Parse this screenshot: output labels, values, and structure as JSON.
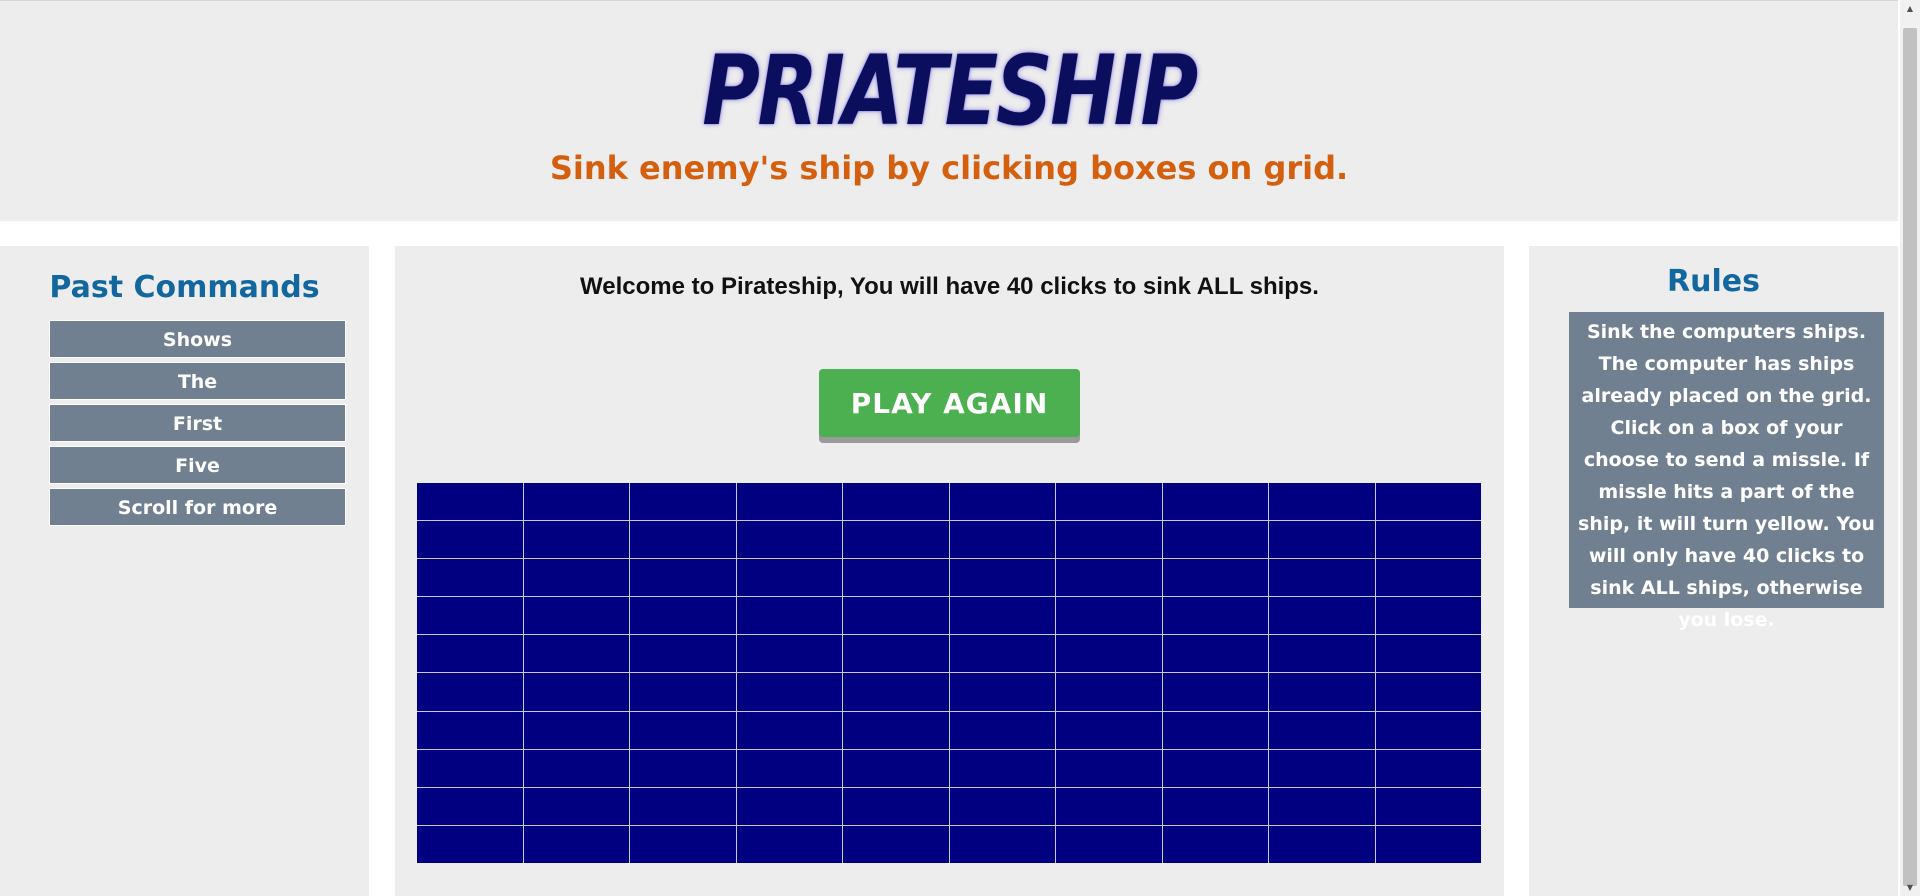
{
  "header": {
    "title": "PRIATESHIP",
    "subtitle": "Sink enemy's ship by clicking boxes on grid."
  },
  "past_commands": {
    "title": "Past Commands",
    "items": [
      "Shows",
      "The",
      "First",
      "Five",
      "Scroll for more"
    ]
  },
  "main": {
    "welcome": "Welcome to Pirateship, You will have 40 clicks to sink ALL ships.",
    "play_again_label": "PLAY AGAIN",
    "grid": {
      "rows": 10,
      "columns": 10,
      "cell_color": "#000080"
    }
  },
  "rules": {
    "title": "Rules",
    "text": "Sink the computers ships. The computer has ships already placed on the grid. Click on a box of your choose to send a missle. If missle hits a part of the ship, it will turn yellow. You will only have 40 clicks to sink ALL ships, otherwise you lose."
  },
  "colors": {
    "title": "#0b0e5c",
    "subtitle": "#d4600f",
    "section_heading": "#12689e",
    "command_bg": "#708090",
    "play_button": "#4caf50",
    "panel_bg": "#ededed"
  },
  "icons": {
    "scroll_up": "▲",
    "scroll_down": "▼"
  }
}
